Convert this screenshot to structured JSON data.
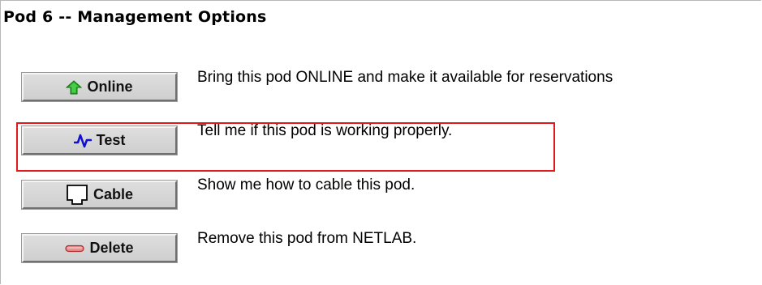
{
  "title": "Pod 6 -- Management Options",
  "options": [
    {
      "button_label": "Online",
      "icon": "green-up-arrow-icon",
      "description": "Bring this pod ONLINE and make it available for reservations"
    },
    {
      "button_label": "Test",
      "icon": "pulse-waveform-icon",
      "description": "Tell me if this pod is working properly."
    },
    {
      "button_label": "Cable",
      "icon": "network-jack-icon",
      "description": "Show me how to cable this pod."
    },
    {
      "button_label": "Delete",
      "icon": "red-minus-icon",
      "description": "Remove this pod from NETLAB."
    }
  ],
  "highlight_color": "#e01a1a",
  "online_icon_color": "#22b022",
  "test_icon_color": "#1010d0",
  "delete_icon_color": "#d84a4a"
}
